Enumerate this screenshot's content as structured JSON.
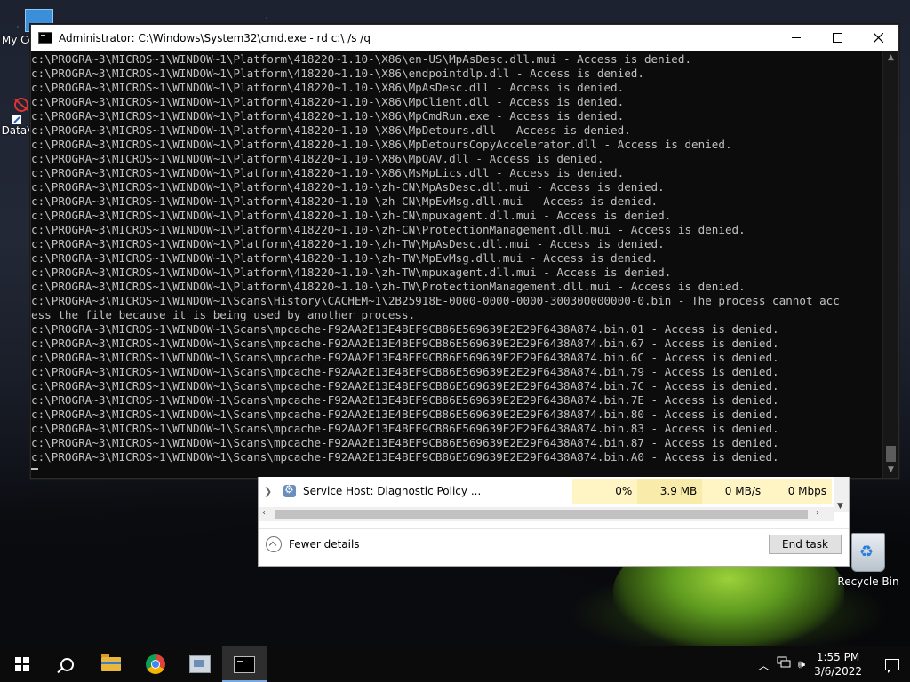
{
  "desktop": {
    "icons": [
      {
        "label": "My Cc"
      },
      {
        "label": "DataV"
      },
      {
        "label": "Recycle Bin"
      }
    ]
  },
  "cmd": {
    "title": "Administrator: C:\\Windows\\System32\\cmd.exe - rd  c:\\ /s /q",
    "lines": [
      "c:\\PROGRA~3\\MICROS~1\\WINDOW~1\\Platform\\418220~1.10-\\X86\\en-US\\MpAsDesc.dll.mui - Access is denied.",
      "c:\\PROGRA~3\\MICROS~1\\WINDOW~1\\Platform\\418220~1.10-\\X86\\endpointdlp.dll - Access is denied.",
      "c:\\PROGRA~3\\MICROS~1\\WINDOW~1\\Platform\\418220~1.10-\\X86\\MpAsDesc.dll - Access is denied.",
      "c:\\PROGRA~3\\MICROS~1\\WINDOW~1\\Platform\\418220~1.10-\\X86\\MpClient.dll - Access is denied.",
      "c:\\PROGRA~3\\MICROS~1\\WINDOW~1\\Platform\\418220~1.10-\\X86\\MpCmdRun.exe - Access is denied.",
      "c:\\PROGRA~3\\MICROS~1\\WINDOW~1\\Platform\\418220~1.10-\\X86\\MpDetours.dll - Access is denied.",
      "c:\\PROGRA~3\\MICROS~1\\WINDOW~1\\Platform\\418220~1.10-\\X86\\MpDetoursCopyAccelerator.dll - Access is denied.",
      "c:\\PROGRA~3\\MICROS~1\\WINDOW~1\\Platform\\418220~1.10-\\X86\\MpOAV.dll - Access is denied.",
      "c:\\PROGRA~3\\MICROS~1\\WINDOW~1\\Platform\\418220~1.10-\\X86\\MsMpLics.dll - Access is denied.",
      "c:\\PROGRA~3\\MICROS~1\\WINDOW~1\\Platform\\418220~1.10-\\zh-CN\\MpAsDesc.dll.mui - Access is denied.",
      "c:\\PROGRA~3\\MICROS~1\\WINDOW~1\\Platform\\418220~1.10-\\zh-CN\\MpEvMsg.dll.mui - Access is denied.",
      "c:\\PROGRA~3\\MICROS~1\\WINDOW~1\\Platform\\418220~1.10-\\zh-CN\\mpuxagent.dll.mui - Access is denied.",
      "c:\\PROGRA~3\\MICROS~1\\WINDOW~1\\Platform\\418220~1.10-\\zh-CN\\ProtectionManagement.dll.mui - Access is denied.",
      "c:\\PROGRA~3\\MICROS~1\\WINDOW~1\\Platform\\418220~1.10-\\zh-TW\\MpAsDesc.dll.mui - Access is denied.",
      "c:\\PROGRA~3\\MICROS~1\\WINDOW~1\\Platform\\418220~1.10-\\zh-TW\\MpEvMsg.dll.mui - Access is denied.",
      "c:\\PROGRA~3\\MICROS~1\\WINDOW~1\\Platform\\418220~1.10-\\zh-TW\\mpuxagent.dll.mui - Access is denied.",
      "c:\\PROGRA~3\\MICROS~1\\WINDOW~1\\Platform\\418220~1.10-\\zh-TW\\ProtectionManagement.dll.mui - Access is denied.",
      "c:\\PROGRA~3\\MICROS~1\\WINDOW~1\\Scans\\History\\CACHEM~1\\2B25918E-0000-0000-0000-300300000000-0.bin - The process cannot acc",
      "ess the file because it is being used by another process.",
      "c:\\PROGRA~3\\MICROS~1\\WINDOW~1\\Scans\\mpcache-F92AA2E13E4BEF9CB86E569639E2E29F6438A874.bin.01 - Access is denied.",
      "c:\\PROGRA~3\\MICROS~1\\WINDOW~1\\Scans\\mpcache-F92AA2E13E4BEF9CB86E569639E2E29F6438A874.bin.67 - Access is denied.",
      "c:\\PROGRA~3\\MICROS~1\\WINDOW~1\\Scans\\mpcache-F92AA2E13E4BEF9CB86E569639E2E29F6438A874.bin.6C - Access is denied.",
      "c:\\PROGRA~3\\MICROS~1\\WINDOW~1\\Scans\\mpcache-F92AA2E13E4BEF9CB86E569639E2E29F6438A874.bin.79 - Access is denied.",
      "c:\\PROGRA~3\\MICROS~1\\WINDOW~1\\Scans\\mpcache-F92AA2E13E4BEF9CB86E569639E2E29F6438A874.bin.7C - Access is denied.",
      "c:\\PROGRA~3\\MICROS~1\\WINDOW~1\\Scans\\mpcache-F92AA2E13E4BEF9CB86E569639E2E29F6438A874.bin.7E - Access is denied.",
      "c:\\PROGRA~3\\MICROS~1\\WINDOW~1\\Scans\\mpcache-F92AA2E13E4BEF9CB86E569639E2E29F6438A874.bin.80 - Access is denied.",
      "c:\\PROGRA~3\\MICROS~1\\WINDOW~1\\Scans\\mpcache-F92AA2E13E4BEF9CB86E569639E2E29F6438A874.bin.83 - Access is denied.",
      "c:\\PROGRA~3\\MICROS~1\\WINDOW~1\\Scans\\mpcache-F92AA2E13E4BEF9CB86E569639E2E29F6438A874.bin.87 - Access is denied.",
      "c:\\PROGRA~3\\MICROS~1\\WINDOW~1\\Scans\\mpcache-F92AA2E13E4BEF9CB86E569639E2E29F6438A874.bin.A0 - Access is denied."
    ]
  },
  "taskmgr": {
    "row": {
      "name": "Service Host: Diagnostic Policy ...",
      "cpu": "0%",
      "memory": "3.9 MB",
      "disk": "0 MB/s",
      "network": "0 Mbps"
    },
    "fewer_details": "Fewer details",
    "end_task": "End task"
  },
  "taskbar": {
    "apps": [
      "start-icon",
      "search-icon",
      "file-explorer-icon",
      "chrome-icon",
      "server-manager-icon",
      "cmd-icon"
    ],
    "time": "1:55 PM",
    "date": "3/6/2022"
  }
}
